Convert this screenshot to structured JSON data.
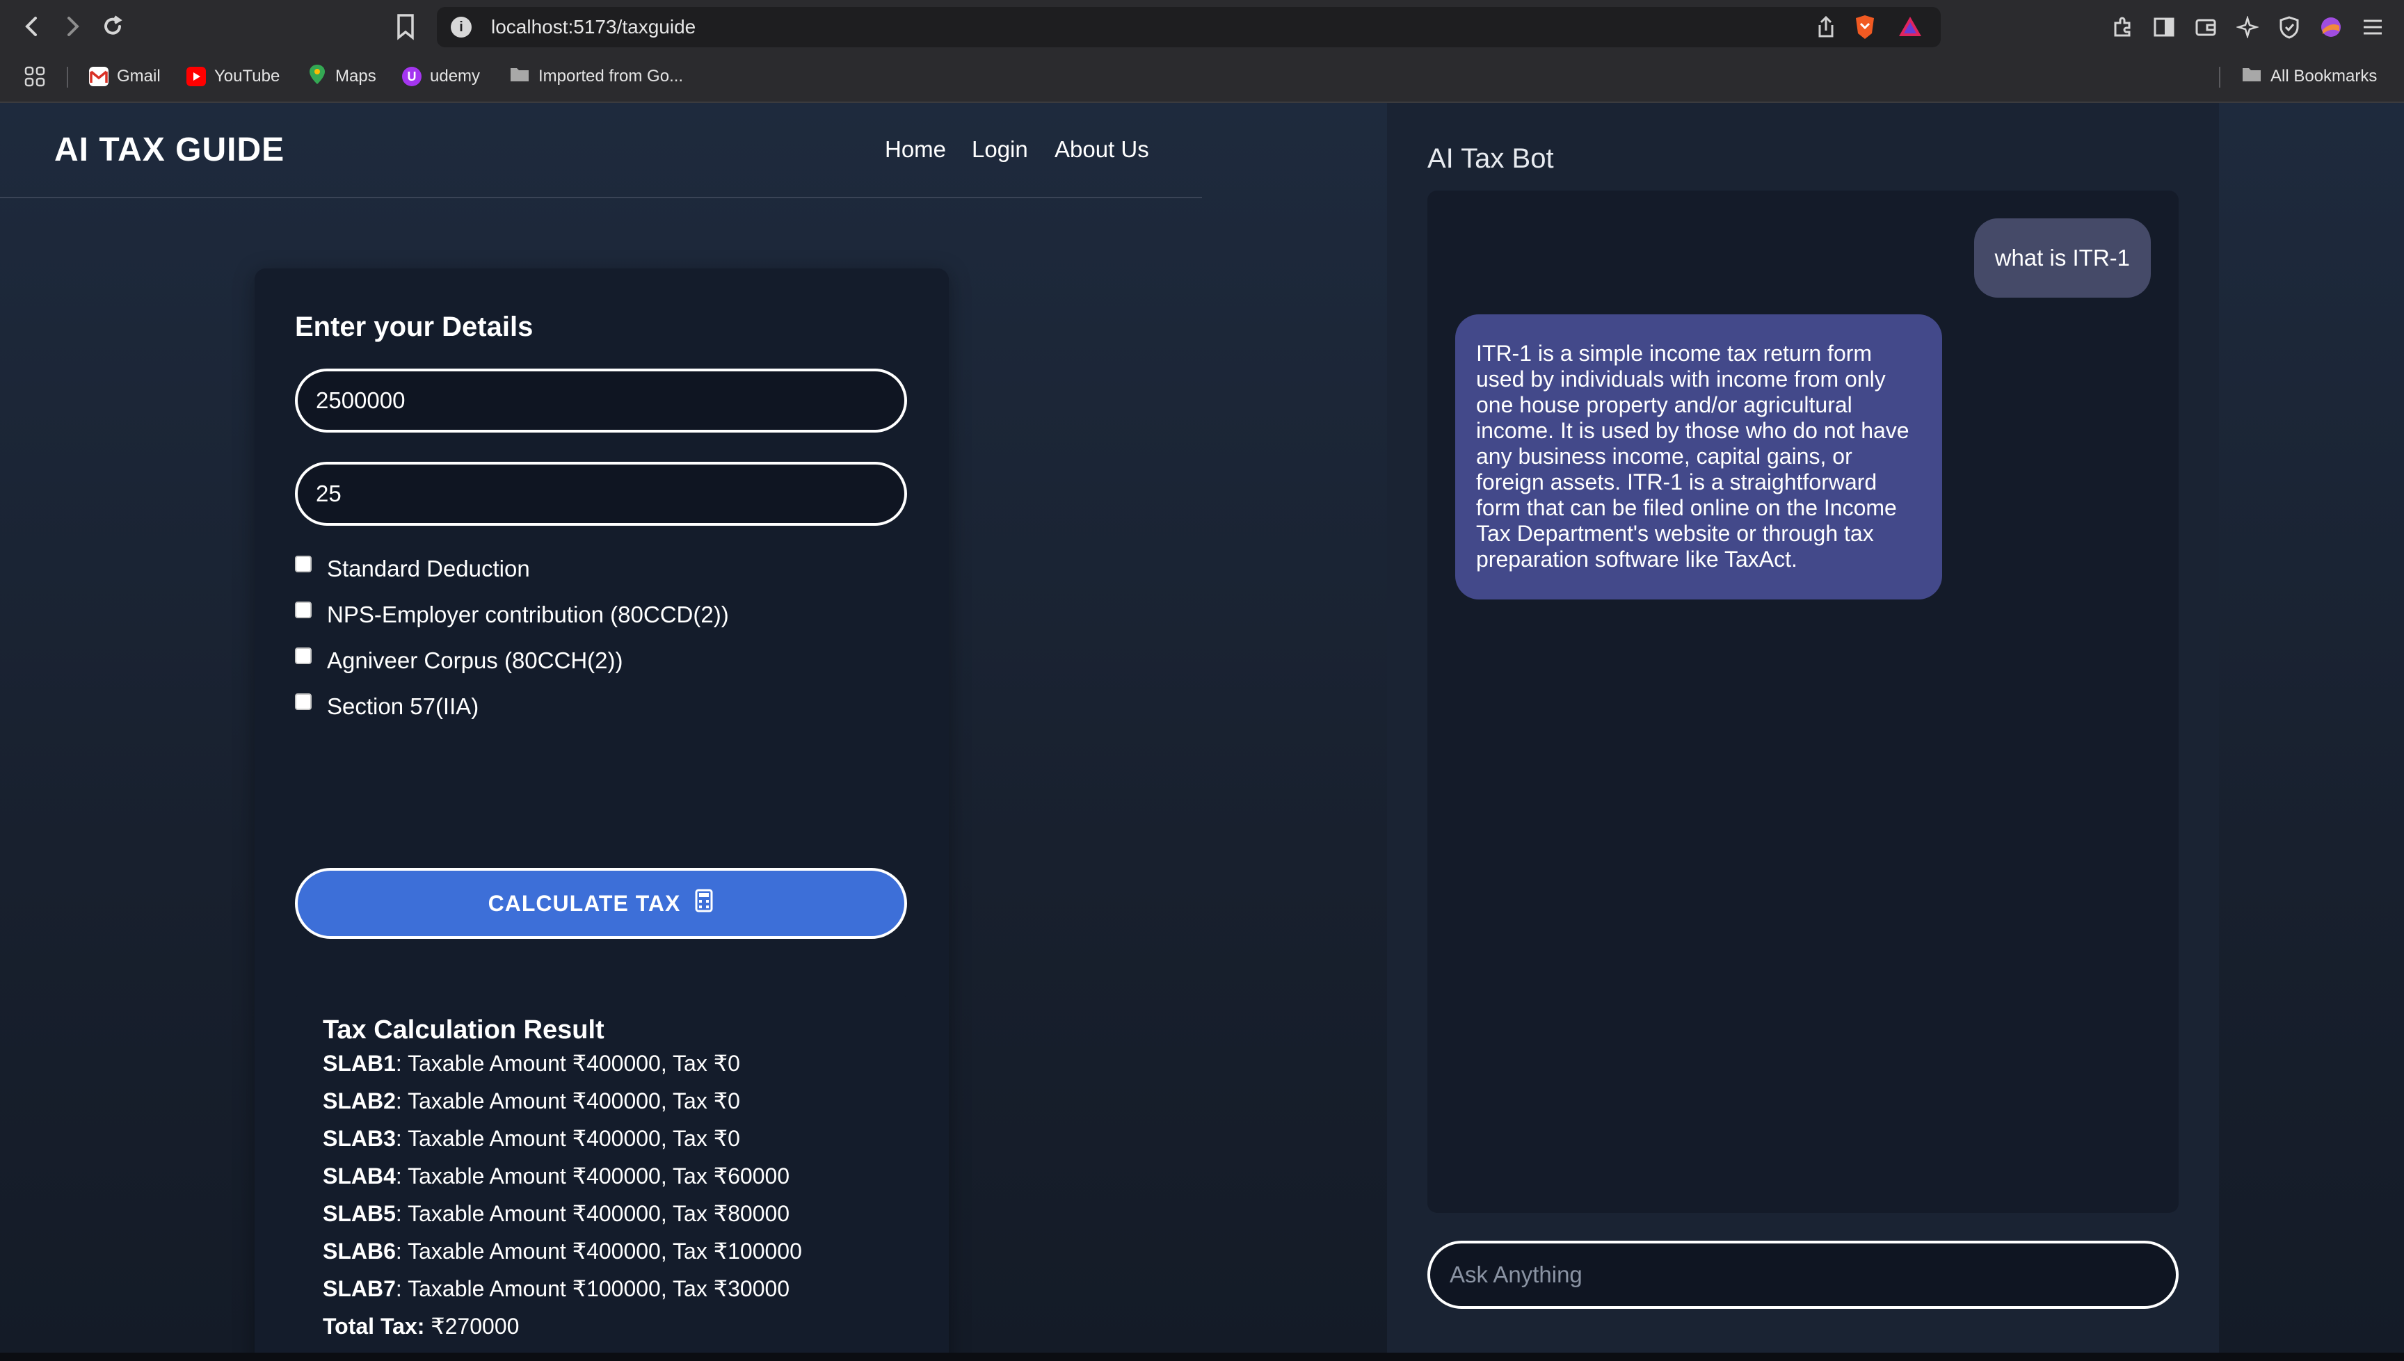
{
  "browser": {
    "url": "localhost:5173/taxguide",
    "bookmarks": [
      {
        "label": "Gmail",
        "color": "#d93025"
      },
      {
        "label": "YouTube",
        "color": "#ff0000"
      },
      {
        "label": "Maps",
        "color": "#34a853"
      },
      {
        "label": "udemy",
        "color": "#a435f0"
      },
      {
        "label": "Imported from Go...",
        "color": "#9a9a9a"
      }
    ],
    "all_bookmarks": "All Bookmarks"
  },
  "header": {
    "brand": "AI TAX GUIDE",
    "nav": [
      "Home",
      "Login",
      "About Us"
    ]
  },
  "form": {
    "title": "Enter your Details",
    "income_value": "2500000",
    "age_value": "25",
    "checkboxes": [
      {
        "label": "Standard Deduction",
        "checked": false
      },
      {
        "label": "NPS-Employer contribution (80CCD(2))",
        "checked": false
      },
      {
        "label": "Agniveer Corpus (80CCH(2))",
        "checked": false
      },
      {
        "label": "Section 57(IIA)",
        "checked": false
      }
    ],
    "calculate_label": "CALCULATE TAX",
    "calculate_icon": "calculator-icon",
    "accent_color": "#3d6fd8"
  },
  "result": {
    "title": "Tax Calculation Result",
    "slabs": [
      {
        "name": "SLAB1",
        "text": ": Taxable Amount ₹400000, Tax ₹0"
      },
      {
        "name": "SLAB2",
        "text": ": Taxable Amount ₹400000, Tax ₹0"
      },
      {
        "name": "SLAB3",
        "text": ": Taxable Amount ₹400000, Tax ₹0"
      },
      {
        "name": "SLAB4",
        "text": ": Taxable Amount ₹400000, Tax ₹60000"
      },
      {
        "name": "SLAB5",
        "text": ": Taxable Amount ₹400000, Tax ₹80000"
      },
      {
        "name": "SLAB6",
        "text": ": Taxable Amount ₹400000, Tax ₹100000"
      },
      {
        "name": "SLAB7",
        "text": ": Taxable Amount ₹100000, Tax ₹30000"
      }
    ],
    "total_label": "Total Tax:",
    "total_value": " ₹270000"
  },
  "chat": {
    "title": "AI Tax Bot",
    "user_message": "what is ITR-1",
    "bot_message": "ITR-1 is a simple income tax return form used by individuals with income from only one house property and/or agricultural income. It is used by those who do not have any business income, capital gains, or foreign assets. ITR-1 is a straightforward form that can be filed online on the Income Tax Department's website or through tax preparation software like TaxAct.",
    "input_placeholder": "Ask Anything",
    "user_bubble_color": "#454a68",
    "bot_bubble_color": "#43498a"
  }
}
